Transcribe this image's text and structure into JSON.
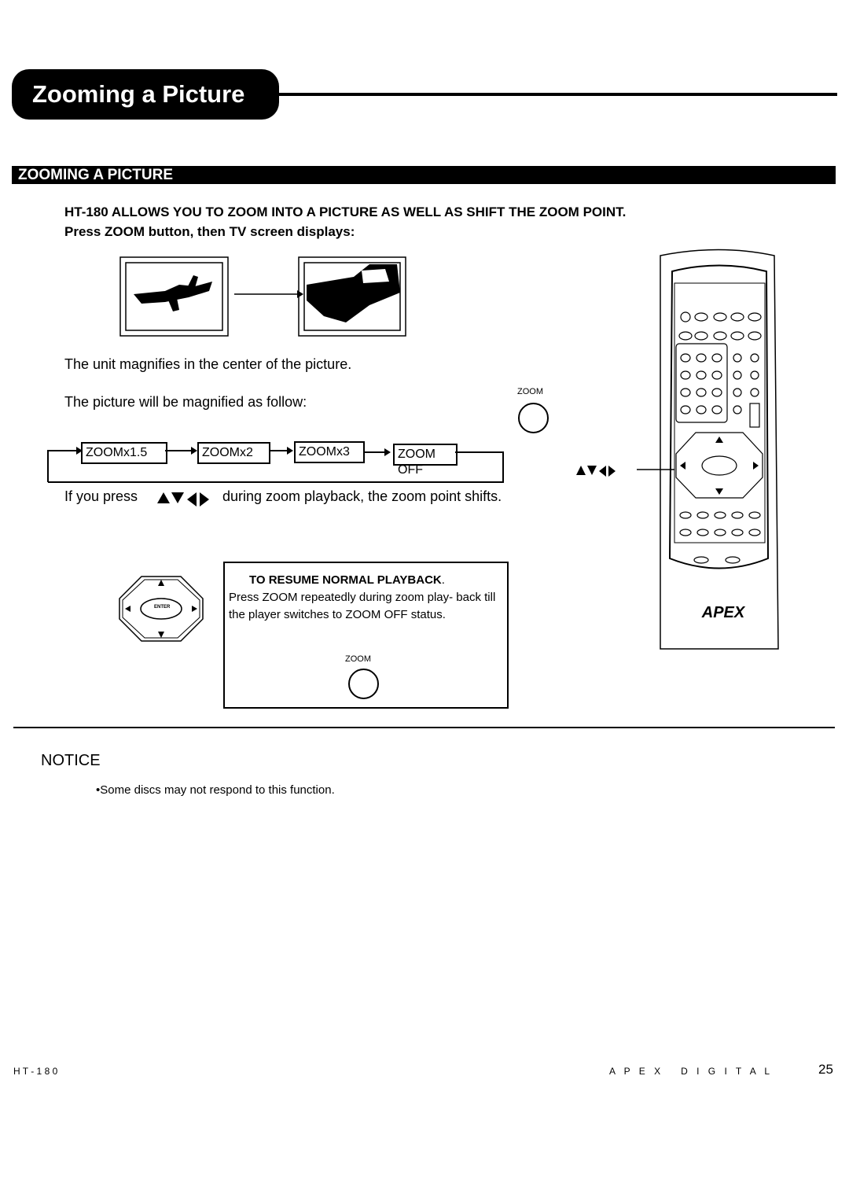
{
  "header": {
    "title": "Zooming a Picture"
  },
  "section": {
    "heading": "ZOOMING A PICTURE"
  },
  "intro": {
    "line1": "HT-180 ALLOWS YOU TO ZOOM INTO A PICTURE AS WELL AS SHIFT THE ZOOM POINT.",
    "line2": "Press ZOOM button, then TV screen displays:"
  },
  "body": {
    "magnify_center": "The unit magnifies in the center of the picture.",
    "magnify_follow": "The picture will be magnified as follow:",
    "zoom_button_label": "ZOOM",
    "press_before": "If you press",
    "press_after": "during zoom playback, the zoom point shifts."
  },
  "sequence": [
    "ZOOMx1.5",
    "ZOOMx2",
    "ZOOMx3",
    "ZOOM OFF"
  ],
  "resume": {
    "title": "TO RESUME NORMAL PLAYBACK",
    "title_suffix": ".",
    "text": "Press ZOOM repeatedly during zoom play- back till the player switches to ZOOM OFF status.",
    "zoom_label": "ZOOM"
  },
  "enter_pad": {
    "enter_label": "ENTER"
  },
  "notice": {
    "heading": "NOTICE",
    "bullet": "•Some discs may not respond to this function."
  },
  "footer": {
    "model": "H T - 1 8 0",
    "brand": "A P E X   D I G I T A L",
    "page": "25"
  }
}
